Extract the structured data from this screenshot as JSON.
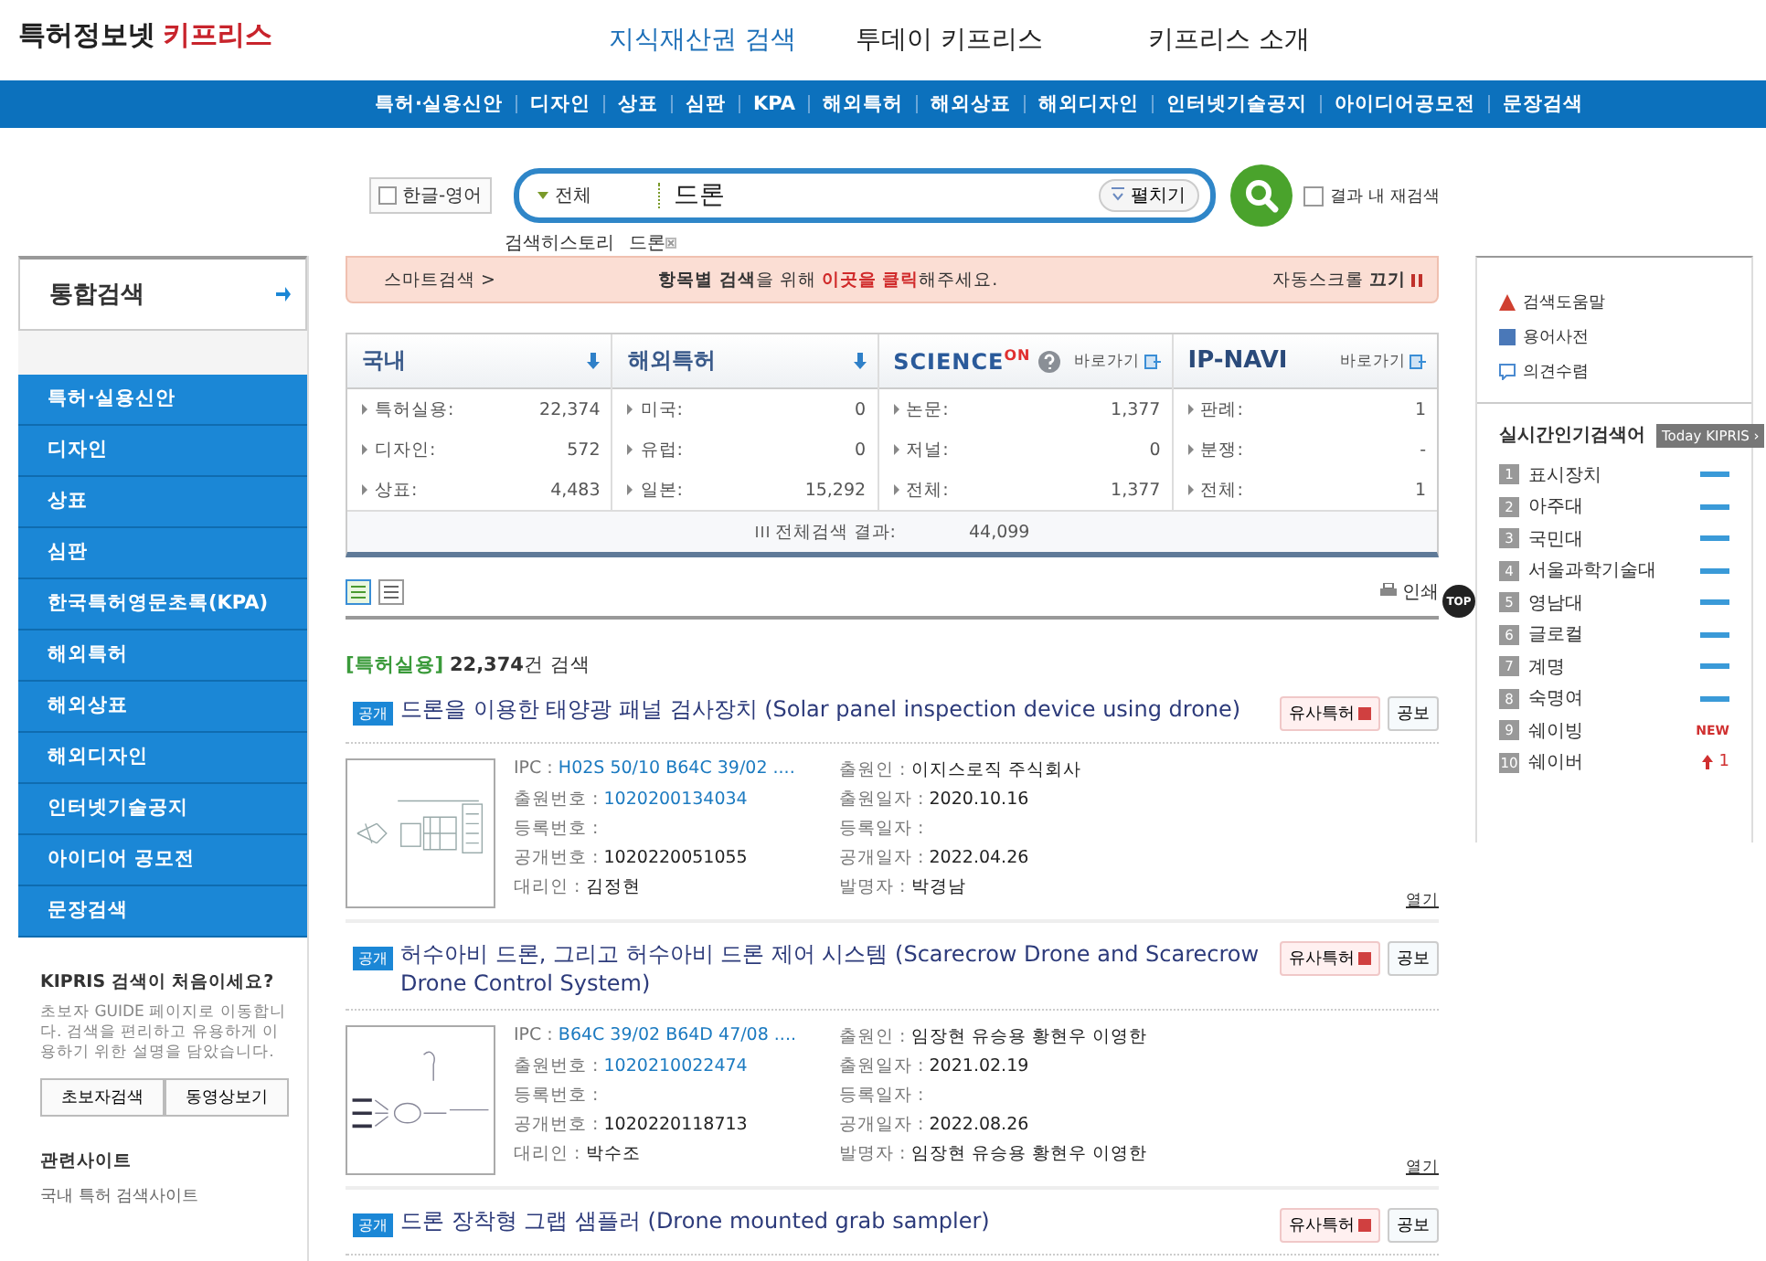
{
  "logo": {
    "main": "특허정보넷",
    "accent": "키프리스"
  },
  "top_nav": [
    {
      "label": "지식재산권 검색",
      "selected": true
    },
    {
      "label": "투데이 키프리스",
      "selected": false
    },
    {
      "label": "키프리스 소개",
      "selected": false
    }
  ],
  "sub_nav": [
    "특허·실용신안",
    "디자인",
    "상표",
    "심판",
    "KPA",
    "해외특허",
    "해외상표",
    "해외디자인",
    "인터넷기술공지",
    "아이디어공모전",
    "문장검색"
  ],
  "search": {
    "lang_toggle": "한글-영어",
    "lang_checked": false,
    "scope": "전체",
    "value": "드론",
    "expand_button": "펼치기",
    "research_label": "결과 내 재검색",
    "research_checked": false,
    "history_label": "검색히스토리",
    "history": [
      "드론"
    ]
  },
  "sidebar": {
    "top": "통합검색",
    "items": [
      "특허·실용신안",
      "디자인",
      "상표",
      "심판",
      "한국특허영문초록(KPA)",
      "해외특허",
      "해외상표",
      "해외디자인",
      "인터넷기술공지",
      "아이디어 공모전",
      "문장검색"
    ],
    "guide": {
      "title": "KIPRIS 검색이 처음이세요?",
      "text": "초보자 GUIDE 페이지로 이동합니다. 검색을 편리하고 유용하게 이용하기 위한 설명을 담았습니다.",
      "buttons": [
        "초보자검색",
        "동영상보기"
      ]
    },
    "related": {
      "title": "관련사이트",
      "item": "국내 특허 검색사이트"
    }
  },
  "smart_bar": {
    "label": "스마트검색 >",
    "pre": "**항목별 검색**을 위해 ",
    "link": "이곳을 클릭",
    "post": "해주세요.",
    "auto_scroll": "자동스크롤 **끄기**"
  },
  "summary": {
    "columns": [
      {
        "kind": "text",
        "header": "국내",
        "rows": [
          {
            "label": "특허실용:",
            "value": "22,374"
          },
          {
            "label": "디자인:",
            "value": "572"
          },
          {
            "label": "상표:",
            "value": "4,483"
          }
        ]
      },
      {
        "kind": "text",
        "header": "해외특허",
        "rows": [
          {
            "label": "미국:",
            "value": "0"
          },
          {
            "label": "유럽:",
            "value": "0"
          },
          {
            "label": "일본:",
            "value": "15,292"
          }
        ]
      },
      {
        "kind": "science",
        "header": "SCIENCE",
        "header_accent": "ON",
        "link": "바로가기",
        "rows": [
          {
            "label": "논문:",
            "value": "1,377"
          },
          {
            "label": "저널:",
            "value": "0"
          },
          {
            "label": "전체:",
            "value": "1,377"
          }
        ]
      },
      {
        "kind": "ipnavi",
        "header": "IP-NAVI",
        "link": "바로가기",
        "rows": [
          {
            "label": "판례:",
            "value": "1"
          },
          {
            "label": "분쟁:",
            "value": "-"
          },
          {
            "label": "전체:",
            "value": "1"
          }
        ]
      }
    ],
    "total_label": "전체검색 결과:",
    "total_value": "44,099"
  },
  "print": "인쇄",
  "result_heading": {
    "category": "[특허실용]",
    "count": "22,374",
    "suffix": "건 검색"
  },
  "results": [
    {
      "kind": "panel",
      "badge": "공개",
      "title": "드론을 이용한 태양광 패널 검사장치 (Solar panel inspection device using drone)",
      "buttons": [
        "유사특허",
        "공보"
      ],
      "left": [
        {
          "label": "IPC :",
          "value": "H02S 50/10 B64C 39/02 ....",
          "linked": true
        },
        {
          "label": "출원번호 :",
          "value": "1020200134034",
          "linked": true
        },
        {
          "label": "등록번호 :"
        },
        {
          "label": "공개번호 :",
          "value": "1020220051055",
          "linked": false
        },
        {
          "label": "대리인 :",
          "value": "김정현",
          "linked": false
        }
      ],
      "right": [
        {
          "label": "출원인 :",
          "value": "이지스로직 주식회사"
        },
        {
          "label": "출원일자 :",
          "value": "2020.10.16"
        },
        {
          "label": "등록일자 :"
        },
        {
          "label": "공개일자 :",
          "value": "2022.04.26"
        },
        {
          "label": "발명자 :",
          "value": "박경남"
        }
      ],
      "open": "열기"
    },
    {
      "kind": "scarecrow",
      "badge": "공개",
      "title": "허수아비 드론, 그리고 허수아비 드론 제어 시스템 (Scarecrow Drone and Scarecrow Drone Control System)",
      "buttons": [
        "유사특허",
        "공보"
      ],
      "left": [
        {
          "label": "IPC :",
          "value": "B64C 39/02 B64D 47/08 ....",
          "linked": true
        },
        {
          "label": "출원번호 :",
          "value": "1020210022474",
          "linked": true
        },
        {
          "label": "등록번호 :"
        },
        {
          "label": "공개번호 :",
          "value": "1020220118713",
          "linked": false
        },
        {
          "label": "대리인 :",
          "value": "박수조",
          "linked": false
        }
      ],
      "right": [
        {
          "label": "출원인 :",
          "value": "임장현 유승용 황현우 이영한"
        },
        {
          "label": "출원일자 :",
          "value": "2021.02.19"
        },
        {
          "label": "등록일자 :"
        },
        {
          "label": "공개일자 :",
          "value": "2022.08.26"
        },
        {
          "label": "발명자 :",
          "value": "임장현 유승용 황현우 이영한"
        }
      ],
      "open": "열기"
    },
    {
      "badge": "공개",
      "title": "드론 장착형 그랩 샘플러 (Drone mounted grab sampler)",
      "buttons": [
        "유사특허",
        "공보"
      ]
    }
  ],
  "help_links": [
    {
      "kind": "help",
      "label": "검색도움말"
    },
    {
      "kind": "dictionary",
      "label": "용어사전"
    },
    {
      "kind": "opinion",
      "label": "의견수렴"
    }
  ],
  "popular": {
    "title": "실시간인기검색어",
    "badge": "Today KIPRIS ›",
    "items": [
      {
        "rank": "1",
        "term": "표시장치",
        "kind": "same"
      },
      {
        "rank": "2",
        "term": "아주대",
        "kind": "same"
      },
      {
        "rank": "3",
        "term": "국민대",
        "kind": "same"
      },
      {
        "rank": "4",
        "term": "서울과학기술대",
        "kind": "same"
      },
      {
        "rank": "5",
        "term": "영남대",
        "kind": "same"
      },
      {
        "rank": "6",
        "term": "글로컬",
        "kind": "same"
      },
      {
        "rank": "7",
        "term": "계명",
        "kind": "same"
      },
      {
        "rank": "8",
        "term": "숙명여",
        "kind": "same"
      },
      {
        "rank": "9",
        "term": "쉐이빙",
        "kind": "new",
        "trend_text": "NEW"
      },
      {
        "rank": "10",
        "term": "쉐이버",
        "kind": "up",
        "trend_text": "1"
      }
    ]
  },
  "top_button": "TOP"
}
